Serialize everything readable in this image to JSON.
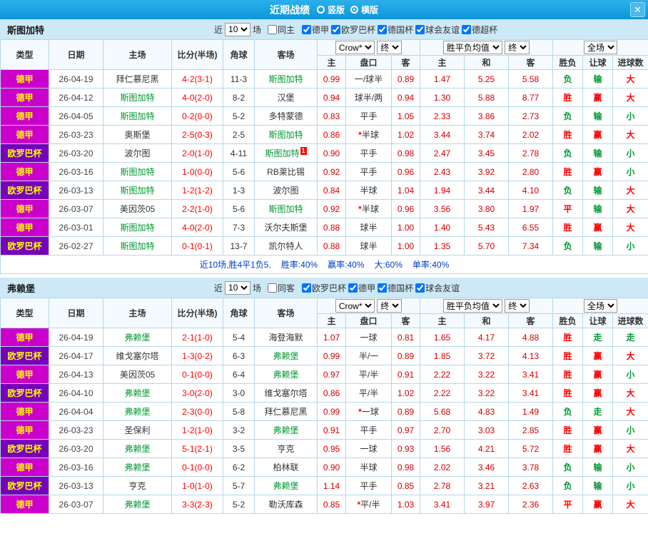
{
  "titlebar": {
    "title": "近期战绩",
    "layout_options": [
      {
        "label": "竖版",
        "selected": false
      },
      {
        "label": "横版",
        "selected": true
      }
    ],
    "close_icon": "✕"
  },
  "colors": {
    "titlebar_bg": "#14a0e2",
    "section_band_bg": "#cde8f6",
    "league_bundesliga_bg": "#cc00cc",
    "league_europa_bg": "#7700bb",
    "league_text": "#ffff00",
    "focus_team_green": "#009933",
    "score_red": "#ff0000",
    "odds_red": "#d40000",
    "win_red": "#ff0000",
    "lose_green": "#009933",
    "summary_blue": "#0040cc"
  },
  "sections": [
    {
      "team": "斯图加特",
      "filter": {
        "near_label": "近",
        "count": "10",
        "unit_label": "场",
        "venue": {
          "label": "同主",
          "checked": false
        },
        "leagues": [
          {
            "label": "德甲",
            "checked": true
          },
          {
            "label": "欧罗巴杯",
            "checked": true
          },
          {
            "label": "德国杯",
            "checked": true
          },
          {
            "label": "球会友谊",
            "checked": true
          },
          {
            "label": "德超杯",
            "checked": true
          }
        ]
      },
      "header": {
        "type": "类型",
        "date": "日期",
        "home": "主场",
        "score": "比分(半场)",
        "corner": "角球",
        "away": "客场",
        "odds_company": "Crow*",
        "odds_final": "终",
        "avg_label": "胜平负均值",
        "avg_final": "终",
        "scope": "全场",
        "sub": [
          "主",
          "盘口",
          "客",
          "主",
          "和",
          "客",
          "胜负",
          "让球",
          "进球数"
        ]
      },
      "rows": [
        {
          "league": "德甲",
          "lg": "jia",
          "date": "26-04-19",
          "home": "拜仁慕尼黑",
          "home_focus": false,
          "score": "4-2(3-1)",
          "corner": "11-3",
          "away": "斯图加特",
          "away_focus": true,
          "odds": [
            "0.99",
            "一/球半",
            "0.89"
          ],
          "avg": [
            "1.47",
            "5.25",
            "5.58"
          ],
          "res": [
            [
              "负",
              "g"
            ],
            [
              "输",
              "g"
            ],
            [
              "大",
              "r"
            ]
          ]
        },
        {
          "league": "德甲",
          "lg": "jia",
          "date": "26-04-12",
          "home": "斯图加特",
          "home_focus": true,
          "score": "4-0(2-0)",
          "corner": "8-2",
          "away": "汉堡",
          "away_focus": false,
          "odds": [
            "0.94",
            "球半/两",
            "0.94"
          ],
          "avg": [
            "1.30",
            "5.88",
            "8.77"
          ],
          "res": [
            [
              "胜",
              "r"
            ],
            [
              "赢",
              "r"
            ],
            [
              "大",
              "r"
            ]
          ]
        },
        {
          "league": "德甲",
          "lg": "jia",
          "date": "26-04-05",
          "home": "斯图加特",
          "home_focus": true,
          "score": "0-2(0-0)",
          "corner": "5-2",
          "away": "多特蒙德",
          "away_focus": false,
          "odds": [
            "0.83",
            "平手",
            "1.05"
          ],
          "avg": [
            "2.33",
            "3.86",
            "2.73"
          ],
          "res": [
            [
              "负",
              "g"
            ],
            [
              "输",
              "g"
            ],
            [
              "小",
              "g"
            ]
          ]
        },
        {
          "league": "德甲",
          "lg": "jia",
          "date": "26-03-23",
          "home": "奥斯堡",
          "home_focus": false,
          "score": "2-5(0-3)",
          "corner": "2-5",
          "away": "斯图加特",
          "away_focus": true,
          "odds": [
            "0.86",
            "*半球",
            "1.02"
          ],
          "avg": [
            "3.44",
            "3.74",
            "2.02"
          ],
          "res": [
            [
              "胜",
              "r"
            ],
            [
              "赢",
              "r"
            ],
            [
              "大",
              "r"
            ]
          ]
        },
        {
          "league": "欧罗巴杯",
          "lg": "ou",
          "date": "26-03-20",
          "home": "波尔图",
          "home_focus": false,
          "score": "2-0(1-0)",
          "corner": "4-11",
          "away": "斯图加特",
          "away_focus": true,
          "away_badge": "1",
          "odds": [
            "0.90",
            "平手",
            "0.98"
          ],
          "avg": [
            "2.47",
            "3.45",
            "2.78"
          ],
          "res": [
            [
              "负",
              "g"
            ],
            [
              "输",
              "g"
            ],
            [
              "小",
              "g"
            ]
          ]
        },
        {
          "league": "德甲",
          "lg": "jia",
          "date": "26-03-16",
          "home": "斯图加特",
          "home_focus": true,
          "score": "1-0(0-0)",
          "corner": "5-6",
          "away": "RB莱比锡",
          "away_focus": false,
          "odds": [
            "0.92",
            "平手",
            "0.96"
          ],
          "avg": [
            "2.43",
            "3.92",
            "2.80"
          ],
          "res": [
            [
              "胜",
              "r"
            ],
            [
              "赢",
              "r"
            ],
            [
              "小",
              "g"
            ]
          ]
        },
        {
          "league": "欧罗巴杯",
          "lg": "ou",
          "date": "26-03-13",
          "home": "斯图加特",
          "home_focus": true,
          "score": "1-2(1-2)",
          "corner": "1-3",
          "away": "波尔图",
          "away_focus": false,
          "odds": [
            "0.84",
            "半球",
            "1.04"
          ],
          "avg": [
            "1.94",
            "3.44",
            "4.10"
          ],
          "res": [
            [
              "负",
              "g"
            ],
            [
              "输",
              "g"
            ],
            [
              "大",
              "r"
            ]
          ]
        },
        {
          "league": "德甲",
          "lg": "jia",
          "date": "26-03-07",
          "home": "美因茨05",
          "home_focus": false,
          "score": "2-2(1-0)",
          "corner": "5-6",
          "away": "斯图加特",
          "away_focus": true,
          "odds": [
            "0.92",
            "*半球",
            "0.96"
          ],
          "avg": [
            "3.56",
            "3.80",
            "1.97"
          ],
          "res": [
            [
              "平",
              "r"
            ],
            [
              "输",
              "g"
            ],
            [
              "大",
              "r"
            ]
          ]
        },
        {
          "league": "德甲",
          "lg": "jia",
          "date": "26-03-01",
          "home": "斯图加特",
          "home_focus": true,
          "score": "4-0(2-0)",
          "corner": "7-3",
          "away": "沃尔夫斯堡",
          "away_focus": false,
          "odds": [
            "0.88",
            "球半",
            "1.00"
          ],
          "avg": [
            "1.40",
            "5.43",
            "6.55"
          ],
          "res": [
            [
              "胜",
              "r"
            ],
            [
              "赢",
              "r"
            ],
            [
              "大",
              "r"
            ]
          ]
        },
        {
          "league": "欧罗巴杯",
          "lg": "ou",
          "date": "26-02-27",
          "home": "斯图加特",
          "home_focus": true,
          "score": "0-1(0-1)",
          "corner": "13-7",
          "away": "凯尔特人",
          "away_focus": false,
          "odds": [
            "0.88",
            "球半",
            "1.00"
          ],
          "avg": [
            "1.35",
            "5.70",
            "7.34"
          ],
          "res": [
            [
              "负",
              "g"
            ],
            [
              "输",
              "g"
            ],
            [
              "小",
              "g"
            ]
          ]
        }
      ],
      "summary": [
        "近10场,胜4平1负5,",
        "胜率:40%",
        "赢率:40%",
        "大:60%",
        "单率:40%"
      ]
    },
    {
      "team": "弗赖堡",
      "filter": {
        "near_label": "近",
        "count": "10",
        "unit_label": "场",
        "venue": {
          "label": "同客",
          "checked": false
        },
        "leagues": [
          {
            "label": "欧罗巴杯",
            "checked": true
          },
          {
            "label": "德甲",
            "checked": true
          },
          {
            "label": "德国杯",
            "checked": true
          },
          {
            "label": "球会友谊",
            "checked": true
          }
        ]
      },
      "header": {
        "type": "类型",
        "date": "日期",
        "home": "主场",
        "score": "比分(半场)",
        "corner": "角球",
        "away": "客场",
        "odds_company": "Crow*",
        "odds_final": "终",
        "avg_label": "胜平负均值",
        "avg_final": "终",
        "scope": "全场",
        "sub": [
          "主",
          "盘口",
          "客",
          "主",
          "和",
          "客",
          "胜负",
          "让球",
          "进球数"
        ]
      },
      "rows": [
        {
          "league": "德甲",
          "lg": "jia",
          "date": "26-04-19",
          "home": "弗赖堡",
          "home_focus": true,
          "score": "2-1(1-0)",
          "corner": "5-4",
          "away": "海登海默",
          "away_focus": false,
          "odds": [
            "1.07",
            "一球",
            "0.81"
          ],
          "avg": [
            "1.65",
            "4.17",
            "4.88"
          ],
          "res": [
            [
              "胜",
              "r"
            ],
            [
              "走",
              "g"
            ],
            [
              "走",
              "g"
            ]
          ]
        },
        {
          "league": "欧罗巴杯",
          "lg": "ou",
          "date": "26-04-17",
          "home": "维戈塞尔塔",
          "home_focus": false,
          "score": "1-3(0-2)",
          "corner": "6-3",
          "away": "弗赖堡",
          "away_focus": true,
          "odds": [
            "0.99",
            "半/一",
            "0.89"
          ],
          "avg": [
            "1.85",
            "3.72",
            "4.13"
          ],
          "res": [
            [
              "胜",
              "r"
            ],
            [
              "赢",
              "r"
            ],
            [
              "大",
              "r"
            ]
          ]
        },
        {
          "league": "德甲",
          "lg": "jia",
          "date": "26-04-13",
          "home": "美因茨05",
          "home_focus": false,
          "score": "0-1(0-0)",
          "corner": "6-4",
          "away": "弗赖堡",
          "away_focus": true,
          "odds": [
            "0.97",
            "平/半",
            "0.91"
          ],
          "avg": [
            "2.22",
            "3.22",
            "3.41"
          ],
          "res": [
            [
              "胜",
              "r"
            ],
            [
              "赢",
              "r"
            ],
            [
              "小",
              "g"
            ]
          ]
        },
        {
          "league": "欧罗巴杯",
          "lg": "ou",
          "date": "26-04-10",
          "home": "弗赖堡",
          "home_focus": true,
          "score": "3-0(2-0)",
          "corner": "3-0",
          "away": "维戈塞尔塔",
          "away_focus": false,
          "odds": [
            "0.86",
            "平/半",
            "1.02"
          ],
          "avg": [
            "2.22",
            "3.22",
            "3.41"
          ],
          "res": [
            [
              "胜",
              "r"
            ],
            [
              "赢",
              "r"
            ],
            [
              "大",
              "r"
            ]
          ]
        },
        {
          "league": "德甲",
          "lg": "jia",
          "date": "26-04-04",
          "home": "弗赖堡",
          "home_focus": true,
          "score": "2-3(0-0)",
          "corner": "5-8",
          "away": "拜仁慕尼黑",
          "away_focus": false,
          "odds": [
            "0.99",
            "*一球",
            "0.89"
          ],
          "avg": [
            "5.68",
            "4.83",
            "1.49"
          ],
          "res": [
            [
              "负",
              "g"
            ],
            [
              "走",
              "g"
            ],
            [
              "大",
              "r"
            ]
          ]
        },
        {
          "league": "德甲",
          "lg": "jia",
          "date": "26-03-23",
          "home": "圣保利",
          "home_focus": false,
          "score": "1-2(1-0)",
          "corner": "3-2",
          "away": "弗赖堡",
          "away_focus": true,
          "odds": [
            "0.91",
            "平手",
            "0.97"
          ],
          "avg": [
            "2.70",
            "3.03",
            "2.85"
          ],
          "res": [
            [
              "胜",
              "r"
            ],
            [
              "赢",
              "r"
            ],
            [
              "小",
              "g"
            ]
          ]
        },
        {
          "league": "欧罗巴杯",
          "lg": "ou",
          "date": "26-03-20",
          "home": "弗赖堡",
          "home_focus": true,
          "score": "5-1(2-1)",
          "corner": "3-5",
          "away": "亨克",
          "away_focus": false,
          "odds": [
            "0.95",
            "一球",
            "0.93"
          ],
          "avg": [
            "1.56",
            "4.21",
            "5.72"
          ],
          "res": [
            [
              "胜",
              "r"
            ],
            [
              "赢",
              "r"
            ],
            [
              "大",
              "r"
            ]
          ]
        },
        {
          "league": "德甲",
          "lg": "jia",
          "date": "26-03-16",
          "home": "弗赖堡",
          "home_focus": true,
          "score": "0-1(0-0)",
          "corner": "6-2",
          "away": "柏林联",
          "away_focus": false,
          "odds": [
            "0.90",
            "半球",
            "0.98"
          ],
          "avg": [
            "2.02",
            "3.46",
            "3.78"
          ],
          "res": [
            [
              "负",
              "g"
            ],
            [
              "输",
              "g"
            ],
            [
              "小",
              "g"
            ]
          ]
        },
        {
          "league": "欧罗巴杯",
          "lg": "ou",
          "date": "26-03-13",
          "home": "亨克",
          "home_focus": false,
          "score": "1-0(1-0)",
          "corner": "5-7",
          "away": "弗赖堡",
          "away_focus": true,
          "odds": [
            "1.14",
            "平手",
            "0.85"
          ],
          "avg": [
            "2.78",
            "3.21",
            "2.63"
          ],
          "res": [
            [
              "负",
              "g"
            ],
            [
              "输",
              "g"
            ],
            [
              "小",
              "g"
            ]
          ]
        },
        {
          "league": "德甲",
          "lg": "jia",
          "date": "26-03-07",
          "home": "弗赖堡",
          "home_focus": true,
          "score": "3-3(2-3)",
          "corner": "5-2",
          "away": "勒沃库森",
          "away_focus": false,
          "odds": [
            "0.85",
            "*平/半",
            "1.03"
          ],
          "avg": [
            "3.41",
            "3.97",
            "2.36"
          ],
          "res": [
            [
              "平",
              "r"
            ],
            [
              "赢",
              "r"
            ],
            [
              "大",
              "r"
            ]
          ]
        }
      ]
    }
  ]
}
